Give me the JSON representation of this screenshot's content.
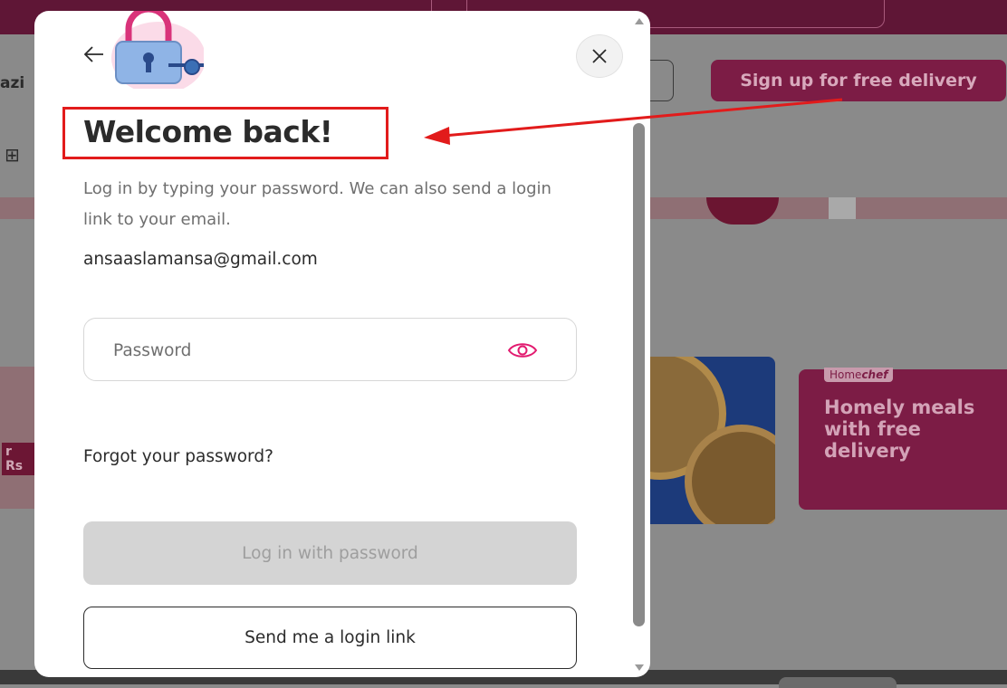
{
  "background": {
    "location_text": "azi",
    "signup_button_label": "Sign up for free delivery",
    "promo_left_text": "r Rs",
    "homechef_tag_plain": "Home",
    "homechef_tag_bold": "chef",
    "homechef_text": "Homely meals with free delivery"
  },
  "modal": {
    "title": "Welcome back!",
    "subtitle": "Log in by typing your password. We can also send a login link to your email.",
    "email": "ansaaslamansa@gmail.com",
    "password_field": {
      "placeholder": "Password",
      "value": ""
    },
    "forgot_link": "Forgot your password?",
    "login_button_label": "Log in with password",
    "login_button_disabled": true,
    "send_link_button_label": "Send me a login link"
  },
  "icons": {
    "back": "arrow-left-icon",
    "close": "close-icon",
    "password_toggle": "eye-icon",
    "illustration": "padlock-key-illustration"
  },
  "colors": {
    "brand_pink": "#e21b70",
    "annotation_red": "#e21b1b",
    "disabled_button": "#d4d4d4",
    "text_primary": "#2b2b2b",
    "text_secondary": "#6f6f6f"
  }
}
